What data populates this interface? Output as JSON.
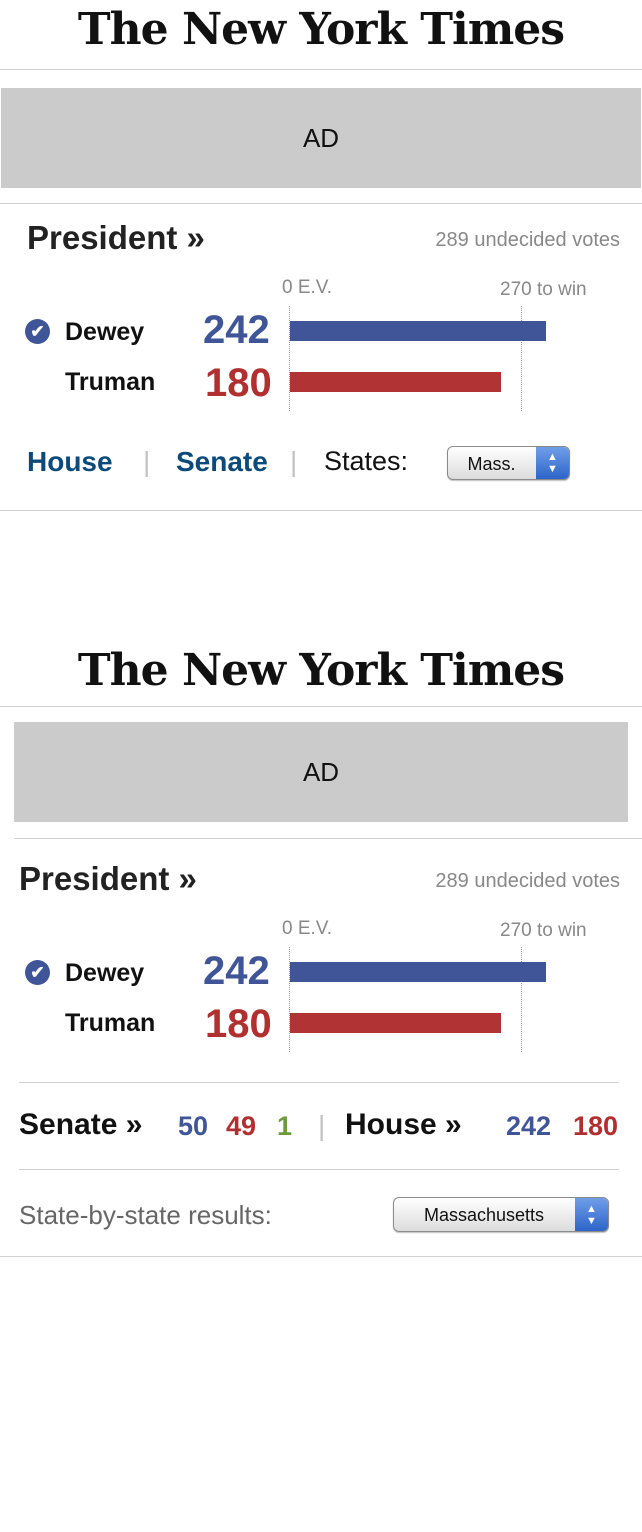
{
  "variant_a": {
    "logo": "The New York Times",
    "ad": "AD",
    "president_heading": "President »",
    "undecided": "289 undecided votes",
    "axis_start": "0 E.V.",
    "axis_goal": "270 to win",
    "candidates": [
      {
        "name": "Dewey",
        "votes": "242",
        "winner": true
      },
      {
        "name": "Truman",
        "votes": "180",
        "winner": false
      }
    ],
    "links": {
      "house": "House",
      "senate": "Senate",
      "separator": "|"
    },
    "states_label": "States:",
    "state_select": "Mass."
  },
  "variant_b": {
    "logo": "The New York Times",
    "ad": "AD",
    "president_heading": "President »",
    "undecided": "289 undecided votes",
    "axis_start": "0 E.V.",
    "axis_goal": "270 to win",
    "candidates": [
      {
        "name": "Dewey",
        "votes": "242",
        "winner": true
      },
      {
        "name": "Truman",
        "votes": "180",
        "winner": false
      }
    ],
    "senate": {
      "label": "Senate »",
      "blue": "50",
      "red": "49",
      "green": "1"
    },
    "house": {
      "label": "House »",
      "blue": "242",
      "red": "180"
    },
    "separator": "|",
    "states_label": "State-by-state results:",
    "state_select": "Massachusetts"
  },
  "icons": {
    "checkmark": "✔",
    "select_arrows": "▲▼"
  },
  "colors": {
    "dem_blue": "#3f5598",
    "rep_red": "#b12f2f",
    "other_green": "#6d9a3c",
    "link_blue": "#0c4a7a",
    "ad_gray": "#cbcbcb"
  }
}
